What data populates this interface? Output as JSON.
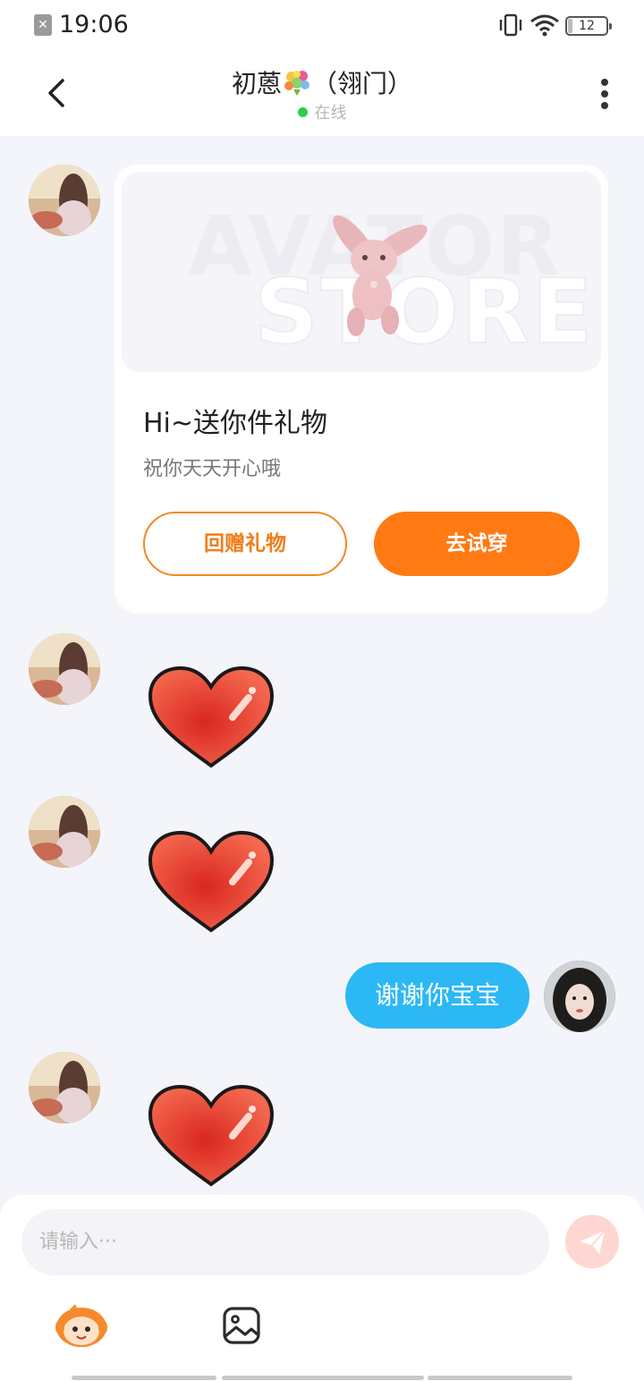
{
  "status_bar": {
    "time": "19:06",
    "battery": "12",
    "battery_level": 0.12
  },
  "header": {
    "name": "初蒽",
    "group": "（翎门）",
    "status": "在线",
    "status_color": "#2ecc4f"
  },
  "gift_card": {
    "watermark_line1": "AVATOR",
    "watermark_line2": "STORE",
    "title": "Hi~送你件礼物",
    "subtitle": "祝你天天开心哦",
    "return_button": "回赠礼物",
    "try_button": "去试穿"
  },
  "messages": [
    {
      "from": "other",
      "type": "gift-card"
    },
    {
      "from": "other",
      "type": "sticker",
      "sticker": "heart-sticker"
    },
    {
      "from": "other",
      "type": "sticker",
      "sticker": "heart-sticker"
    },
    {
      "from": "me",
      "type": "text",
      "text": "谢谢你宝宝"
    },
    {
      "from": "other",
      "type": "sticker",
      "sticker": "heart-sticker"
    }
  ],
  "input": {
    "placeholder": "请输入···"
  },
  "toolbar": {
    "icons": [
      "mascot-icon",
      "image-icon",
      "send-icon"
    ]
  },
  "colors": {
    "accent": "#ff7a12",
    "my_bubble": "#2cb8f5",
    "background": "#f4f5fa"
  }
}
